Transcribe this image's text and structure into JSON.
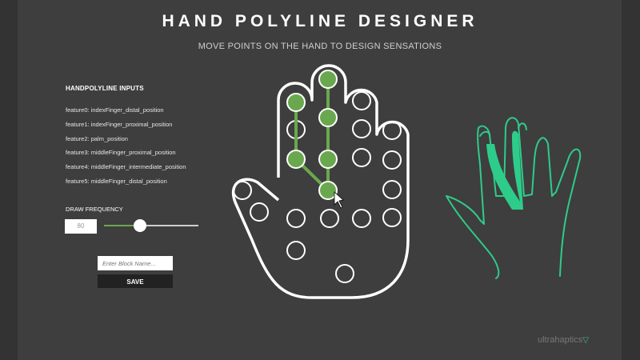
{
  "header": {
    "title": "HAND POLYLINE DESIGNER",
    "subtitle": "MOVE POINTS ON THE HAND TO DESIGN SENSATIONS"
  },
  "inputs": {
    "heading": "HANDPOLYLINE INPUTS",
    "features": [
      "feature0: indexFinger_distal_position",
      "feature1: indexFinger_proximal_position",
      "feature2: palm_position",
      "feature3: middleFinger_proximal_position",
      "feature4: middleFinger_intermediate_position",
      "feature5: middleFinger_distal_position"
    ]
  },
  "frequency": {
    "label": "DRAW FREQUENCY",
    "value": "80",
    "slider_fraction": 0.38
  },
  "block": {
    "placeholder": "Enter Block Name...",
    "save_label": "SAVE"
  },
  "brand": {
    "name": "ultrahaptics",
    "mark": "▽"
  },
  "colors": {
    "accent": "#6aa84f",
    "preview": "#2ecc8a",
    "background": "#3e3e3e"
  }
}
